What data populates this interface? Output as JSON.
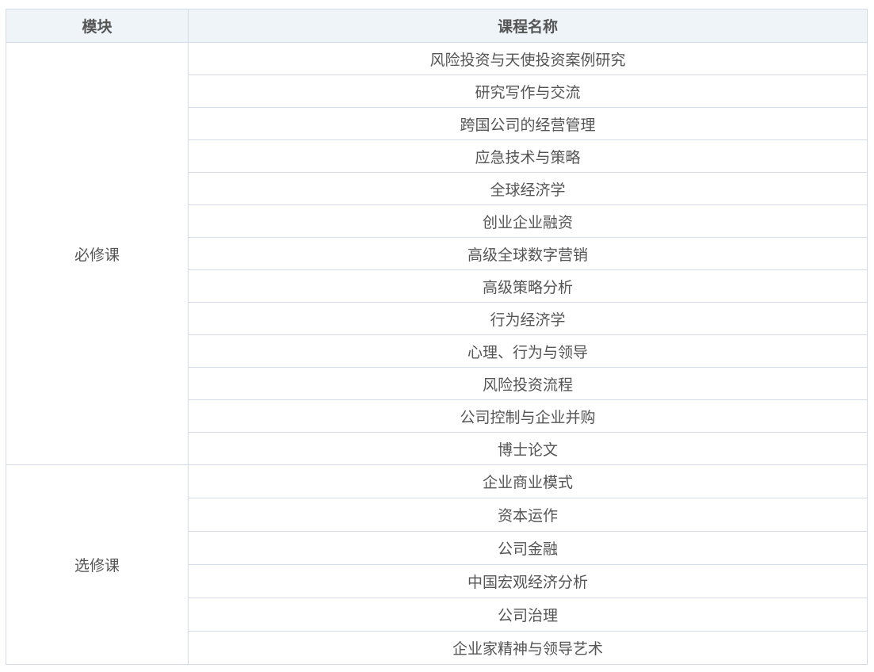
{
  "table": {
    "headers": {
      "module": "模块",
      "course": "课程名称"
    },
    "groups": [
      {
        "module": "必修课",
        "courses": [
          "风险投资与天使投资案例研究",
          "研究写作与交流",
          "跨国公司的经营管理",
          "应急技术与策略",
          "全球经济学",
          "创业企业融资",
          "高级全球数字营销",
          "高级策略分析",
          "行为经济学",
          "心理、行为与领导",
          "风险投资流程",
          "公司控制与企业并购",
          "博士论文"
        ]
      },
      {
        "module": "选修课",
        "courses": [
          "企业商业模式",
          "资本运作",
          "公司金融",
          "中国宏观经济分析",
          "公司治理",
          "企业家精神与领导艺术"
        ]
      }
    ]
  }
}
